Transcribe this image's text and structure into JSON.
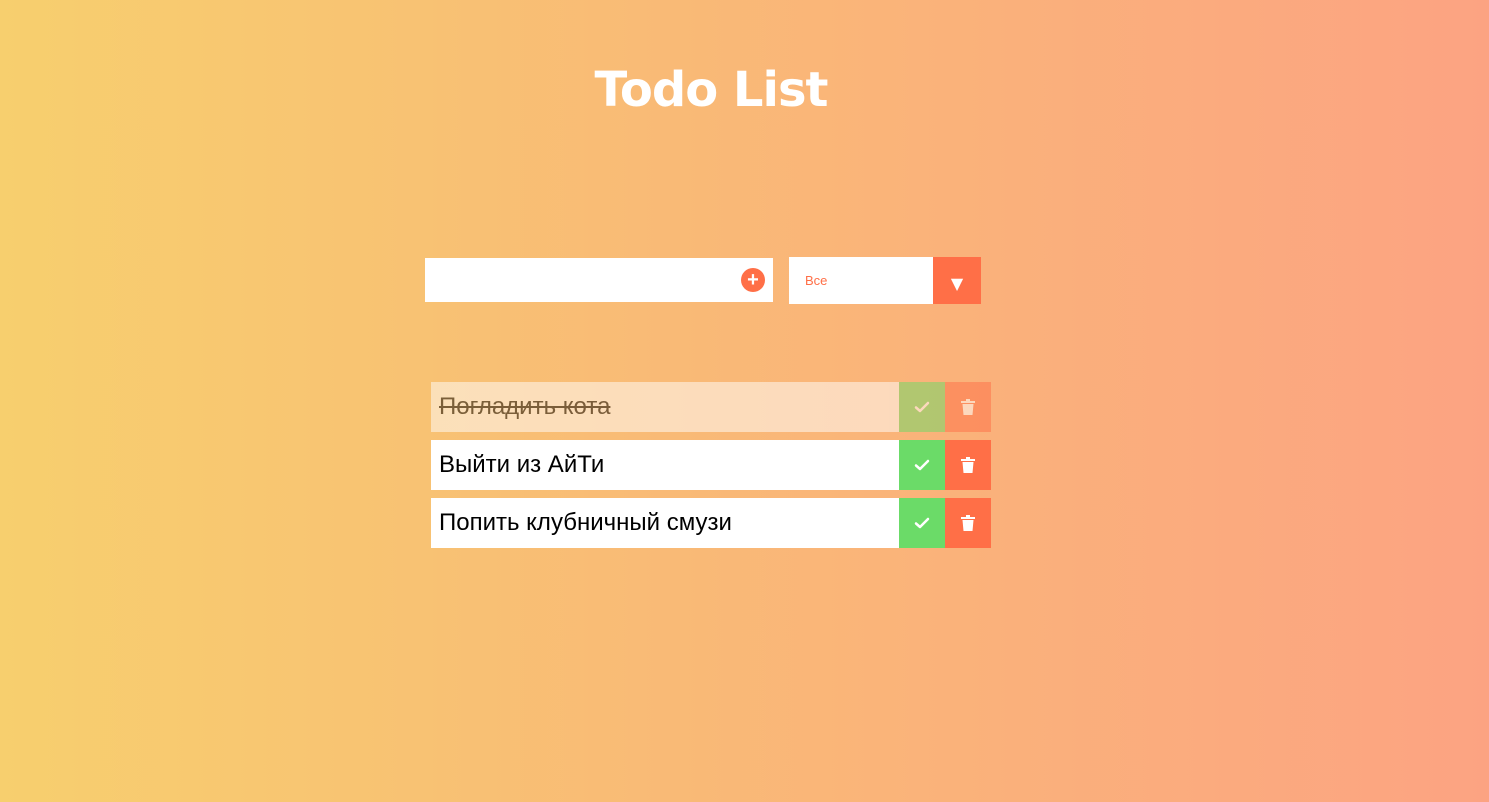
{
  "header": {
    "title": "Todo List"
  },
  "form": {
    "input_value": "",
    "add_icon": "plus-circle-icon",
    "filter": {
      "selected": "Все",
      "arrow_icon": "chevron-down-icon"
    }
  },
  "colors": {
    "accent": "#ff6f47",
    "complete": "#6bdb68",
    "background_start": "#f7cf6e",
    "background_end": "#fca382"
  },
  "todos": [
    {
      "text": "Погладить кота",
      "completed": true
    },
    {
      "text": "Выйти из АйТи",
      "completed": false
    },
    {
      "text": "Попить клубничный смузи",
      "completed": false
    }
  ]
}
